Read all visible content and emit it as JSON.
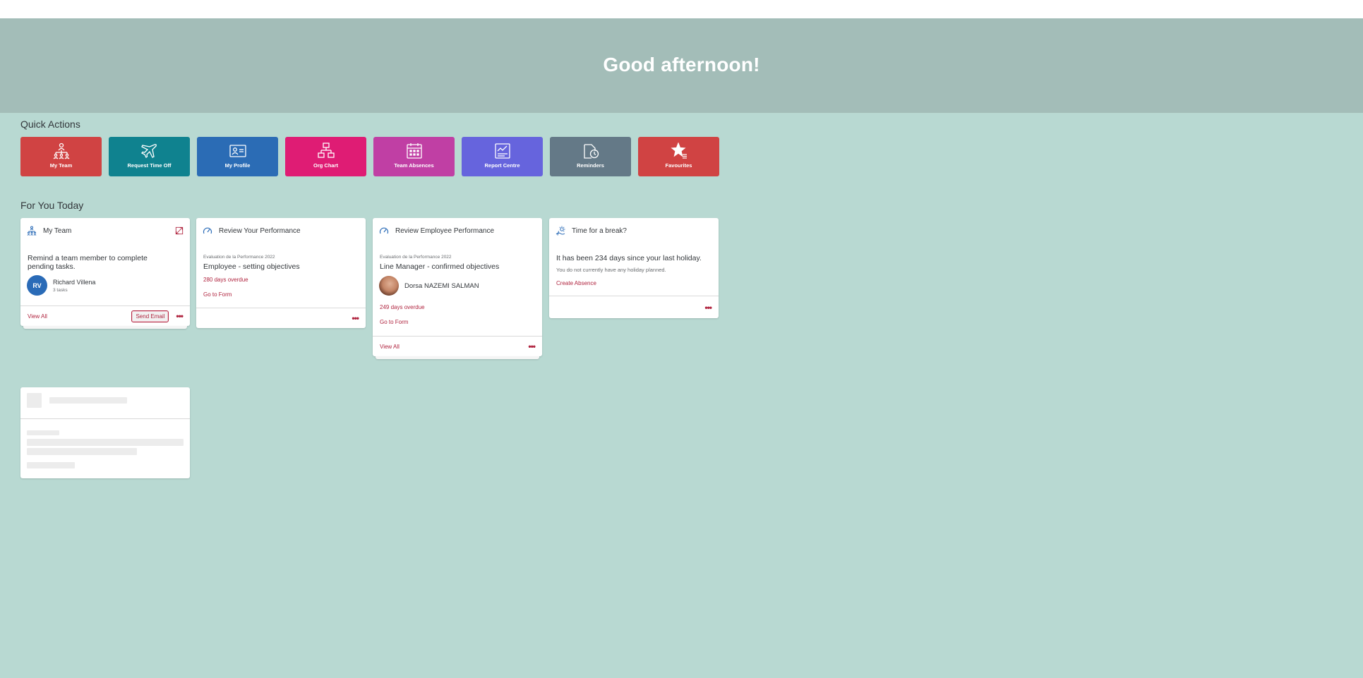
{
  "hero": {
    "greeting": "Good afternoon!"
  },
  "quick_actions": {
    "title": "Quick Actions",
    "items": [
      {
        "label": "My Team",
        "icon": "team-icon",
        "color": "#d04343"
      },
      {
        "label": "Request Time Off",
        "icon": "airplane-icon",
        "color": "#0f828f"
      },
      {
        "label": "My Profile",
        "icon": "profile-card-icon",
        "color": "#2b6cb5"
      },
      {
        "label": "Org Chart",
        "icon": "org-chart-icon",
        "color": "#df1c74"
      },
      {
        "label": "Team Absences",
        "icon": "calendar-icon",
        "color": "#c03fa4"
      },
      {
        "label": "Report Centre",
        "icon": "report-icon",
        "color": "#6664dd"
      },
      {
        "label": "Reminders",
        "icon": "reminder-icon",
        "color": "#647987"
      },
      {
        "label": "Favourites",
        "icon": "favourite-star-icon",
        "color": "#d04343"
      }
    ]
  },
  "for_you_today": {
    "title": "For You Today",
    "my_team": {
      "title": "My Team",
      "text": "Remind a team member to complete pending tasks.",
      "person_initials": "RV",
      "person_name": "Richard Villena",
      "person_tasks": "3 tasks",
      "view_all": "View All",
      "send_email": "Send Email"
    },
    "review_performance": {
      "title": "Review Your Performance",
      "form_name": "Evaluation de la Performance 2022",
      "step": "Employee - setting objectives",
      "overdue": "280 days overdue",
      "go_to_form": "Go to Form"
    },
    "review_employee": {
      "title": "Review Employee Performance",
      "form_name": "Evaluation de la Performance 2022",
      "step": "Line Manager - confirmed objectives",
      "person_name": "Dorsa NAZEMI SALMAN",
      "overdue": "249 days overdue",
      "go_to_form": "Go to Form",
      "view_all": "View All"
    },
    "break": {
      "title": "Time for a break?",
      "text": "It has been 234 days since your last holiday.",
      "subtext": "You do not currently have any holiday planned.",
      "create_absence": "Create Absence"
    }
  },
  "colors": {
    "link": "#b0243f",
    "icon_blue": "#2a6bb7"
  }
}
